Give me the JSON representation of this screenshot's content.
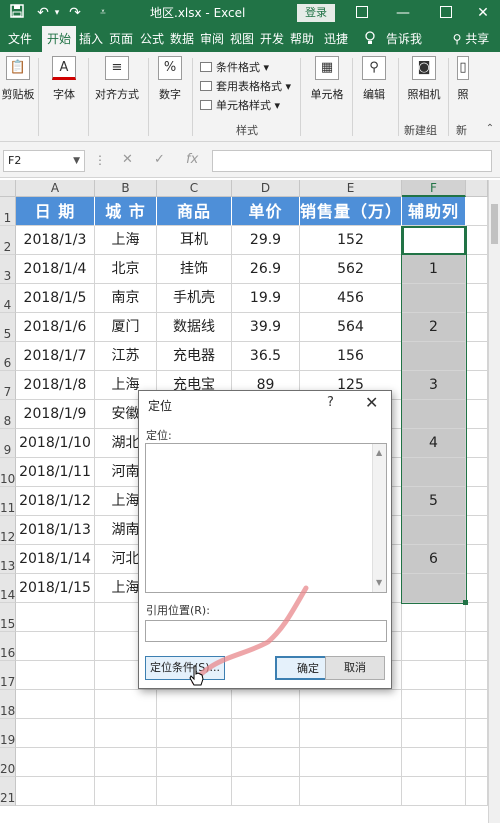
{
  "titlebar": {
    "title": "地区.xlsx  -  Excel",
    "login": "登录",
    "icons": [
      "save-icon",
      "undo-icon",
      "redo-icon",
      "customize-icon"
    ]
  },
  "tabs": [
    "文件",
    "开始",
    "插入",
    "页面",
    "公式",
    "数据",
    "审阅",
    "视图",
    "开发",
    "帮助",
    "迅捷",
    "告诉我",
    "共享"
  ],
  "ribbon": {
    "clipboard": "剪贴板",
    "font": "字体",
    "alignment": "对齐方式",
    "number": "数字",
    "conditional_format": "条件格式",
    "table_format": "套用表格格式",
    "cell_styles": "单元格样式",
    "styles_group": "样式",
    "cells": "单元格",
    "editing": "编辑",
    "camera": "照相机",
    "new_group": "新建组",
    "truncated_label": "照",
    "truncated_group": "新"
  },
  "formula_bar": {
    "name_box": "F2",
    "fx": "fx",
    "value": ""
  },
  "columns": [
    "A",
    "B",
    "C",
    "D",
    "E",
    "F"
  ],
  "rows": [
    "1",
    "2",
    "3",
    "4",
    "5",
    "6",
    "7",
    "8",
    "9",
    "10",
    "11",
    "12",
    "13",
    "14",
    "15",
    "16",
    "17",
    "18",
    "19",
    "20",
    "21"
  ],
  "table": {
    "headers": [
      "日 期",
      "城 市",
      "商品",
      "单价",
      "销售量（万）",
      "辅助列"
    ],
    "data": [
      [
        "2018/1/3",
        "上海",
        "耳机",
        "29.9",
        "152",
        ""
      ],
      [
        "2018/1/4",
        "北京",
        "挂饰",
        "26.9",
        "562",
        "1"
      ],
      [
        "2018/1/5",
        "南京",
        "手机壳",
        "19.9",
        "456",
        ""
      ],
      [
        "2018/1/6",
        "厦门",
        "数据线",
        "39.9",
        "564",
        "2"
      ],
      [
        "2018/1/7",
        "江苏",
        "充电器",
        "36.5",
        "156",
        ""
      ],
      [
        "2018/1/8",
        "上海",
        "充电宝",
        "89",
        "125",
        "3"
      ],
      [
        "2018/1/9",
        "安徽",
        "",
        "",
        "",
        ""
      ],
      [
        "2018/1/10",
        "湖北",
        "",
        "",
        "",
        "4"
      ],
      [
        "2018/1/11",
        "河南",
        "",
        "",
        "",
        ""
      ],
      [
        "2018/1/12",
        "上海",
        "",
        "",
        "",
        "5"
      ],
      [
        "2018/1/13",
        "湖南",
        "",
        "",
        "",
        ""
      ],
      [
        "2018/1/14",
        "河北",
        "",
        "",
        "",
        "6"
      ],
      [
        "2018/1/15",
        "上海",
        "",
        "",
        "",
        ""
      ]
    ]
  },
  "dialog": {
    "title": "定位",
    "help": "?",
    "close": "✕",
    "goto_label": "定位:",
    "reference_label": "引用位置(R):",
    "special_button": "定位条件(S)...",
    "ok_button": "确定",
    "cancel_button": "取消"
  },
  "colors": {
    "excel_green": "#217346",
    "header_blue": "#4e8fd8",
    "helper_gray": "#c8c8c8",
    "annotation_stroke": "#e8888c"
  }
}
